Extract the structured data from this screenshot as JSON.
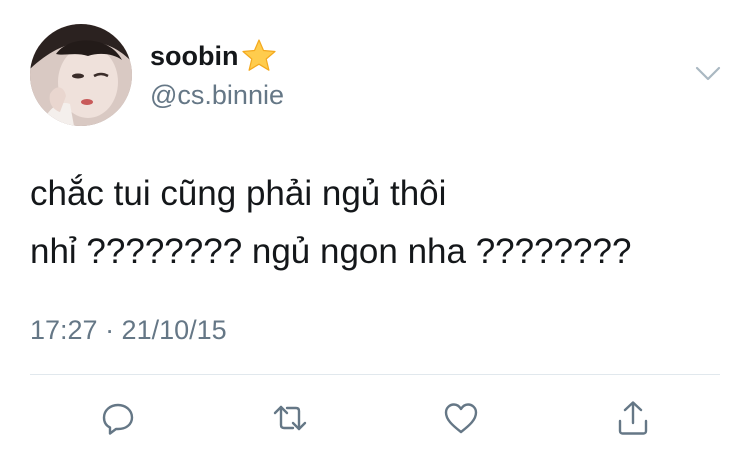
{
  "user": {
    "display_name": "soobin",
    "handle": "@cs.binnie",
    "badge_icon": "star-emoji-icon",
    "avatar_icon": "profile-photo"
  },
  "tweet": {
    "text_line1": "chắc tui cũng phải ngủ thôi",
    "text_line2": "nhỉ ???????? ngủ ngon nha ????????",
    "timestamp": "17:27 · 21/10/15"
  },
  "actions": {
    "reply_icon": "reply-icon",
    "retweet_icon": "retweet-icon",
    "like_icon": "heart-icon",
    "share_icon": "share-icon"
  },
  "colors": {
    "text_primary": "#14171a",
    "text_secondary": "#657786",
    "icon": "#657786",
    "divider": "#e1e8ed",
    "star": "#ffcc4d"
  }
}
